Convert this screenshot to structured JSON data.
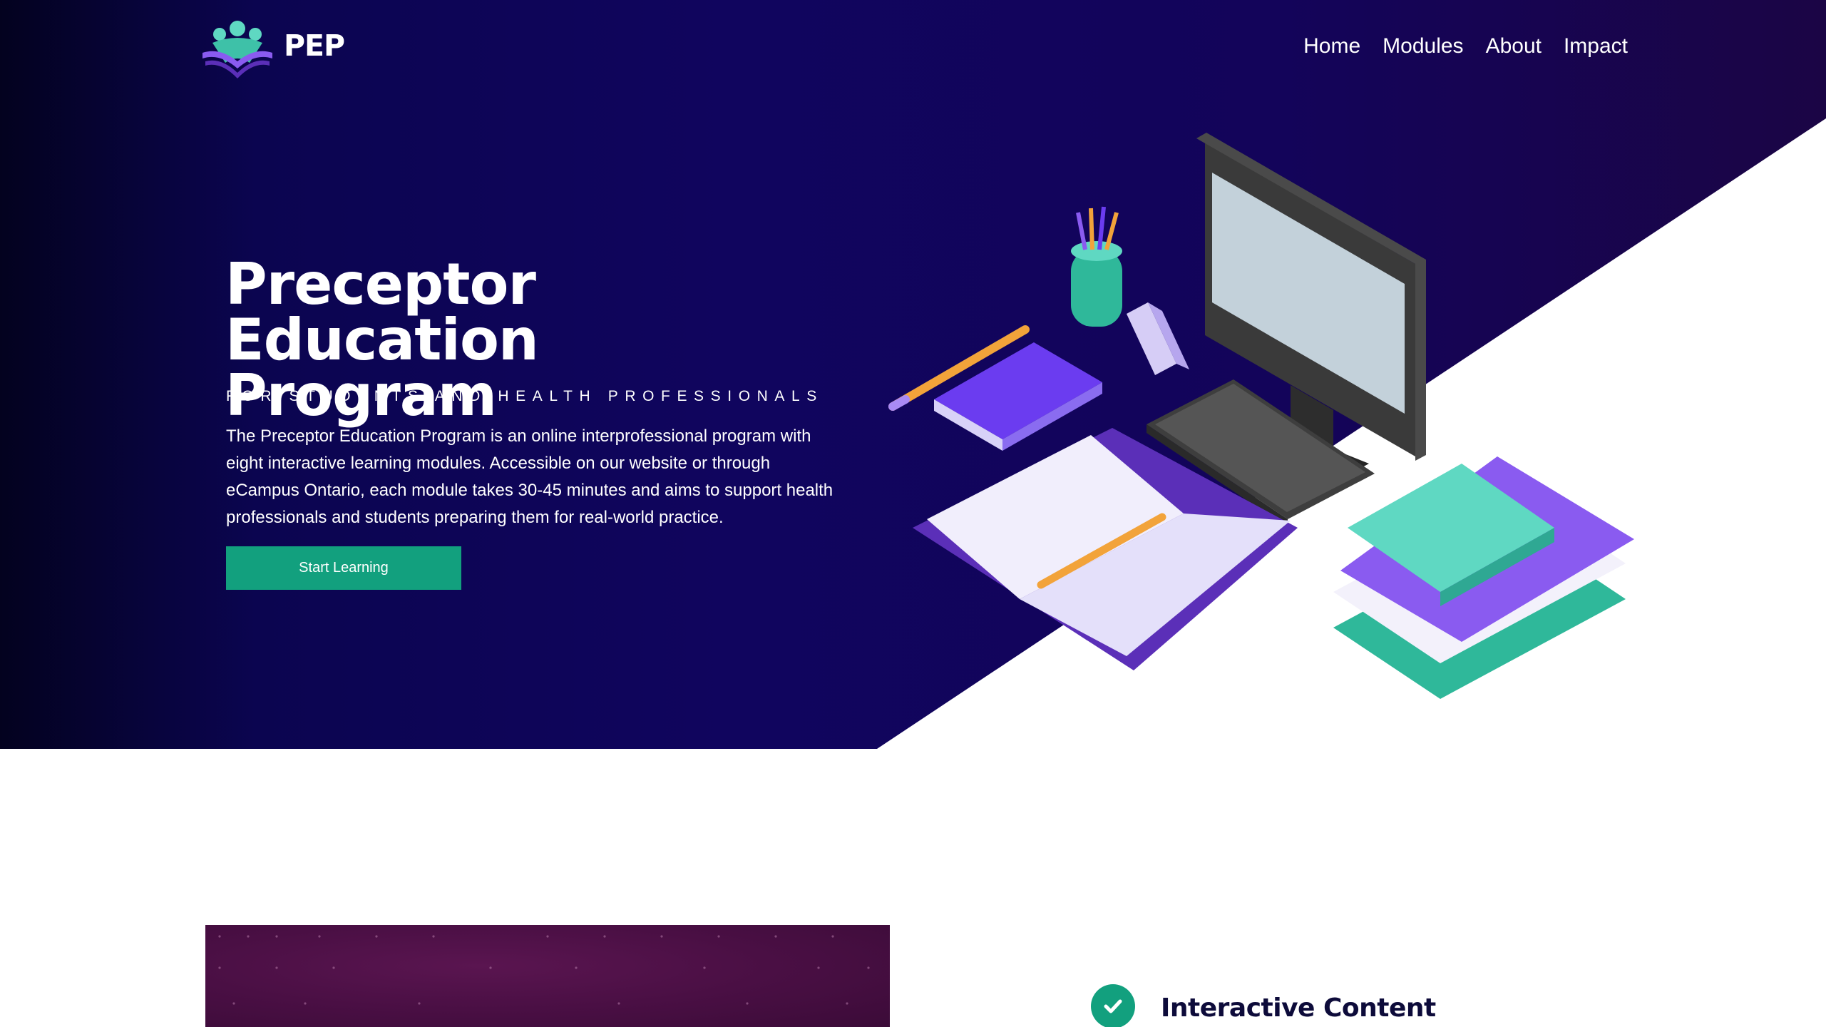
{
  "brand": {
    "name": "PEP"
  },
  "nav": {
    "items": [
      {
        "label": "Home"
      },
      {
        "label": "Modules"
      },
      {
        "label": "About"
      },
      {
        "label": "Impact"
      }
    ]
  },
  "hero": {
    "title_line1": "Preceptor Education",
    "title_line2": "Program",
    "subtitle": "FOR STUDENTS AND HEALTH PROFESSIONALS",
    "description": "The Preceptor Education Program is an online interprofessional program with eight interactive learning modules. Accessible on our website or through eCampus Ontario, each module takes 30-45 minutes and aims to support health professionals and students preparing them for real-world practice.",
    "cta_label": "Start Learning"
  },
  "features": {
    "first_title": "Interactive Content"
  },
  "colors": {
    "hero_bg": "#10055e",
    "accent_teal": "#12a07e",
    "purple": "#6b3cf0",
    "heading_dark": "#0d0b3a"
  },
  "icons": {
    "logo": "pep-logo-icon",
    "check": "check-icon"
  }
}
